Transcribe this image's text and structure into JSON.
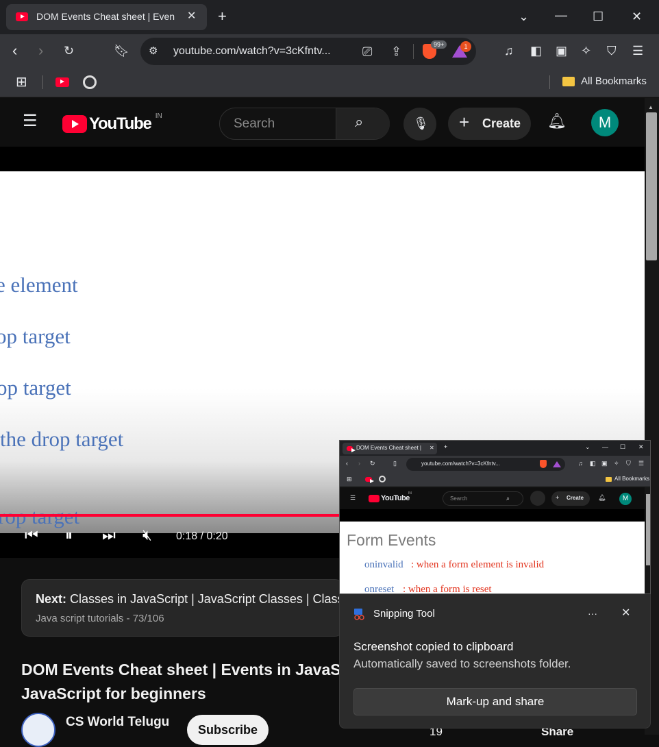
{
  "browser": {
    "tab_title": "DOM Events Cheat sheet | Even",
    "url": "youtube.com/watch?v=3cKfntv...",
    "brave_badge": "99+",
    "rewards_badge": "1",
    "bookmarks_folder": "All Bookmarks"
  },
  "youtube": {
    "logo_text": "YouTube",
    "region": "IN",
    "search_placeholder": "Search",
    "create_label": "Create",
    "avatar_letter": "M"
  },
  "video": {
    "lines": [
      "e element",
      "op target",
      "op target",
      "the drop target",
      "rop target"
    ],
    "time": "0:18 / 0:20",
    "progress": 0.9
  },
  "next": {
    "prefix": "Next:",
    "title": "Classes in JavaScript | JavaScript Classes | Classes",
    "playlist": "Java script tutorials - 73/106"
  },
  "video_title": "DOM Events Cheat sheet | Events in JavaS JavaScript for beginners",
  "channel": {
    "name": "CS World Telugu",
    "subscribe": "Subscribe"
  },
  "partial_controls": {
    "likes": "19",
    "share": "Share"
  },
  "snip_preview": {
    "tab_title": "DOM Events Cheat sheet | Even",
    "url": "youtube.com/watch?v=3cKfntv...",
    "bookmarks_folder": "All Bookmarks",
    "logo_text": "YouTube",
    "region": "IN",
    "search_placeholder": "Search",
    "create_label": "Create",
    "avatar_letter": "M",
    "heading": "Form  Events",
    "items": [
      {
        "event": "oninvalid",
        "desc": ": when  a form  element is invalid"
      },
      {
        "event": "onreset",
        "desc": ": when  a form is reset"
      }
    ]
  },
  "toast": {
    "app_name": "Snipping Tool",
    "more": "···",
    "heading": "Screenshot copied to clipboard",
    "subtext": "Automatically saved to screenshots folder.",
    "action": "Mark-up and share"
  }
}
